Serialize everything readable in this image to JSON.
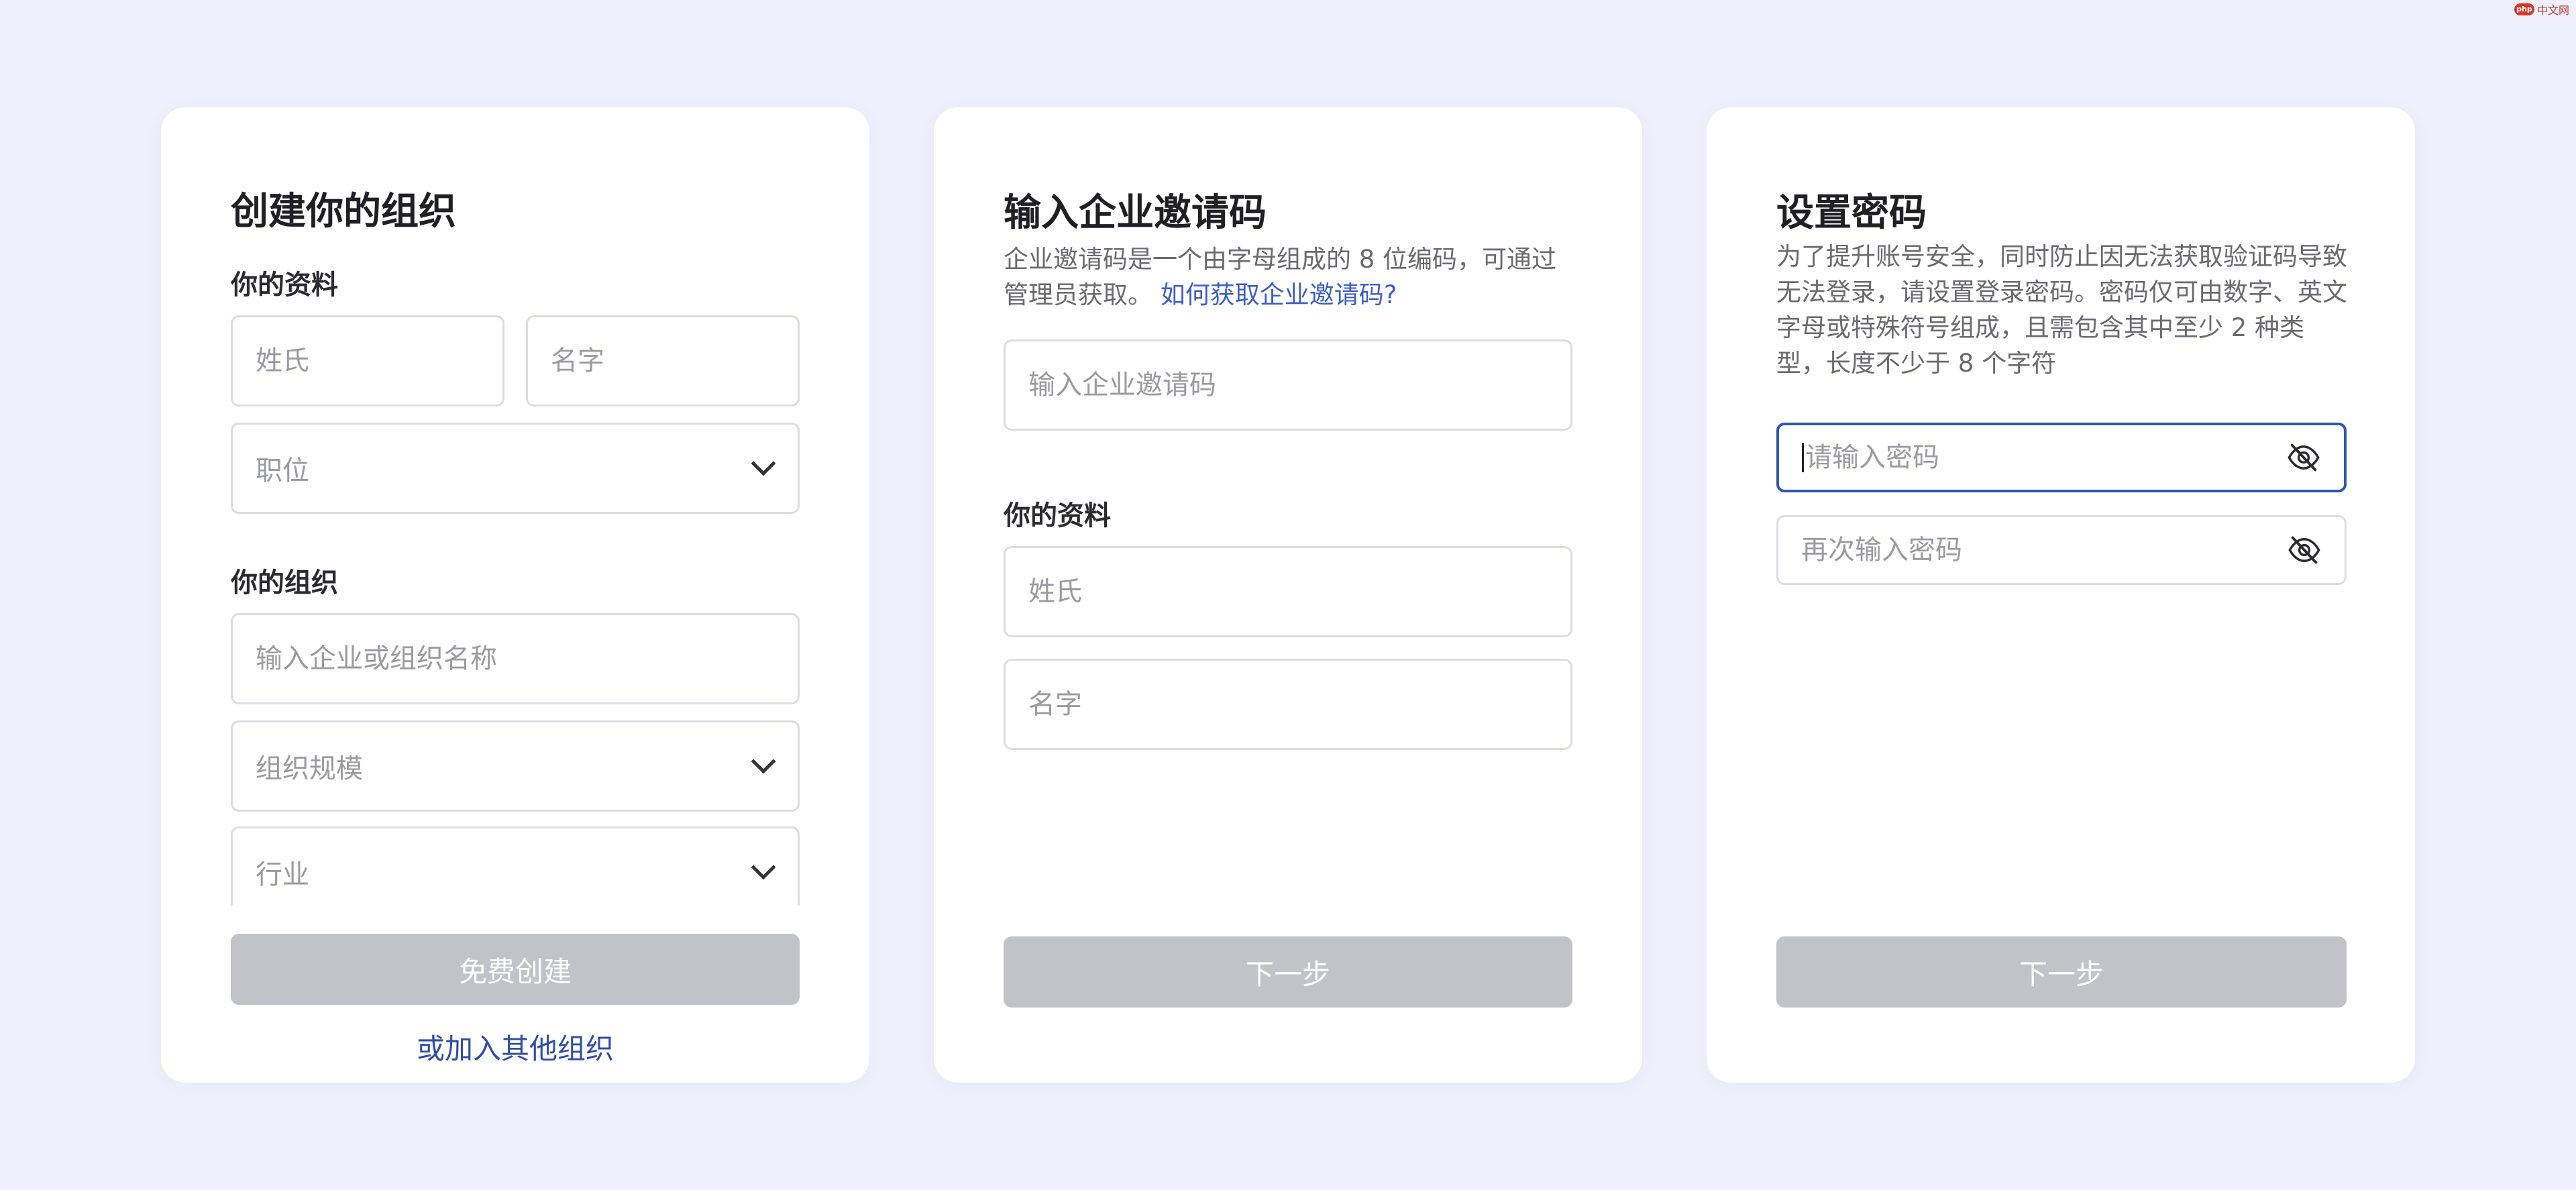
{
  "watermark": {
    "logo": "php",
    "text": "中文网"
  },
  "create_org": {
    "title": "创建你的组织",
    "profile_label": "你的资料",
    "last_name_placeholder": "姓氏",
    "first_name_placeholder": "名字",
    "position_placeholder": "职位",
    "org_label": "你的组织",
    "org_name_placeholder": "输入企业或组织名称",
    "org_size_placeholder": "组织规模",
    "industry_placeholder": "行业",
    "submit_label": "免费创建",
    "join_link": "或加入其他组织"
  },
  "invite_code": {
    "title": "输入企业邀请码",
    "description": "企业邀请码是一个由字母组成的 8 位编码，可通过管理员获取。",
    "help_link": "如何获取企业邀请码?",
    "code_placeholder": "输入企业邀请码",
    "profile_label": "你的资料",
    "last_name_placeholder": "姓氏",
    "first_name_placeholder": "名字",
    "next_label": "下一步"
  },
  "set_password": {
    "title": "设置密码",
    "description": "为了提升账号安全，同时防止因无法获取验证码导致无法登录，请设置登录密码。密码仅可由数字、英文字母或特殊符号组成，且需包含其中至少 2 种类型，长度不少于 8 个字符",
    "password_placeholder": "请输入密码",
    "confirm_placeholder": "再次输入密码",
    "next_label": "下一步"
  },
  "colors": {
    "background": "#f0f0fc",
    "card": "#ffffff",
    "disabled_button": "#c2c3c8",
    "link": "#3d5fc4",
    "focus_border": "#2f56b0"
  }
}
